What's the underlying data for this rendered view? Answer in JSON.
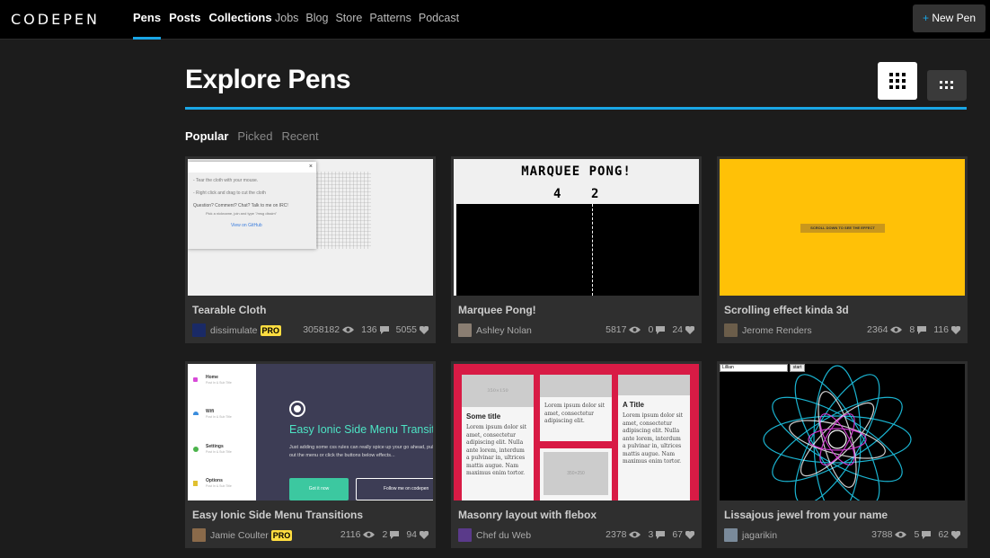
{
  "brand": {
    "logo_text": "CODEPEN"
  },
  "mainnav": [
    {
      "label": "Pens",
      "active": true
    },
    {
      "label": "Posts"
    },
    {
      "label": "Collections"
    }
  ],
  "subnav": [
    "Jobs",
    "Blog",
    "Store",
    "Patterns",
    "Podcast"
  ],
  "new_pen": {
    "plus": "+",
    "label": "New Pen"
  },
  "page": {
    "title": "Explore Pens"
  },
  "tabs": [
    {
      "label": "Popular",
      "active": true
    },
    {
      "label": "Picked"
    },
    {
      "label": "Recent"
    }
  ],
  "colors": {
    "accent": "#19a6e6",
    "pro": "#ffdd40",
    "card": "#2f2f2f"
  },
  "cards": [
    {
      "title": "Tearable Cloth",
      "author": "dissimulate",
      "pro": "PRO",
      "views": "3058182",
      "comments": "136",
      "likes": "5055",
      "preview": {
        "close": "×",
        "lines": [
          "- Tear the cloth with your mouse.",
          "- Right click and drag to cut the cloth",
          "Question? Comment? Chat? Talk to me on IRC!",
          "Pick a nickname, join and type \"/msg dissim\"",
          "View on GitHub"
        ]
      }
    },
    {
      "title": "Marquee Pong!",
      "author": "Ashley Nolan",
      "views": "5817",
      "comments": "0",
      "likes": "24",
      "preview": {
        "heading": "MARQUEE PONG!",
        "score_left": "4",
        "score_right": "2"
      }
    },
    {
      "title": "Scrolling effect kinda 3d",
      "author": "Jerome Renders",
      "views": "2364",
      "comments": "8",
      "likes": "116",
      "preview": {
        "label": "SCROLL DOWN TO SEE THE EFFECT"
      }
    },
    {
      "title": "Easy Ionic Side Menu Transitions",
      "author": "Jamie Coulter",
      "pro": "PRO",
      "views": "2116",
      "comments": "2",
      "likes": "94",
      "preview": {
        "menu": [
          {
            "label": "Home",
            "sub": "Post In & Sub Title"
          },
          {
            "label": "Wifi",
            "sub": "Post In & Sub Title"
          },
          {
            "label": "Settings",
            "sub": "Post In & Sub Title"
          },
          {
            "label": "Options",
            "sub": "Post In & Sub Title"
          }
        ],
        "heading": "Easy Ionic Side Menu Transitions",
        "body": "Just adding some css rules can really spice up your go ahead, pull out the menu or click the buttons below effects...",
        "btn1": "Got it now",
        "btn2": "Follow me on codepen"
      }
    },
    {
      "title": "Masonry layout with flebox",
      "author": "Chef du Web",
      "views": "2378",
      "comments": "3",
      "likes": "67",
      "preview": {
        "placeholder": "350×150",
        "placeholder2": "350×250",
        "title1": "Some title",
        "title2": "A Title",
        "lorem": "Lorem ipsum dolor sit amet, consectetur adipiscing elit. Nulla ante lorem, interdum a pulvinar in, ultrices mattis augue. Nam maximus enim tortor.",
        "lorem_short": "Lorem ipsum dolor sit amet, consectetur adipiscing elit."
      }
    },
    {
      "title": "Lissajous jewel from your name",
      "author": "jagarikin",
      "views": "3788",
      "comments": "5",
      "likes": "62",
      "preview": {
        "input": "Lillian",
        "button": "start"
      }
    }
  ]
}
